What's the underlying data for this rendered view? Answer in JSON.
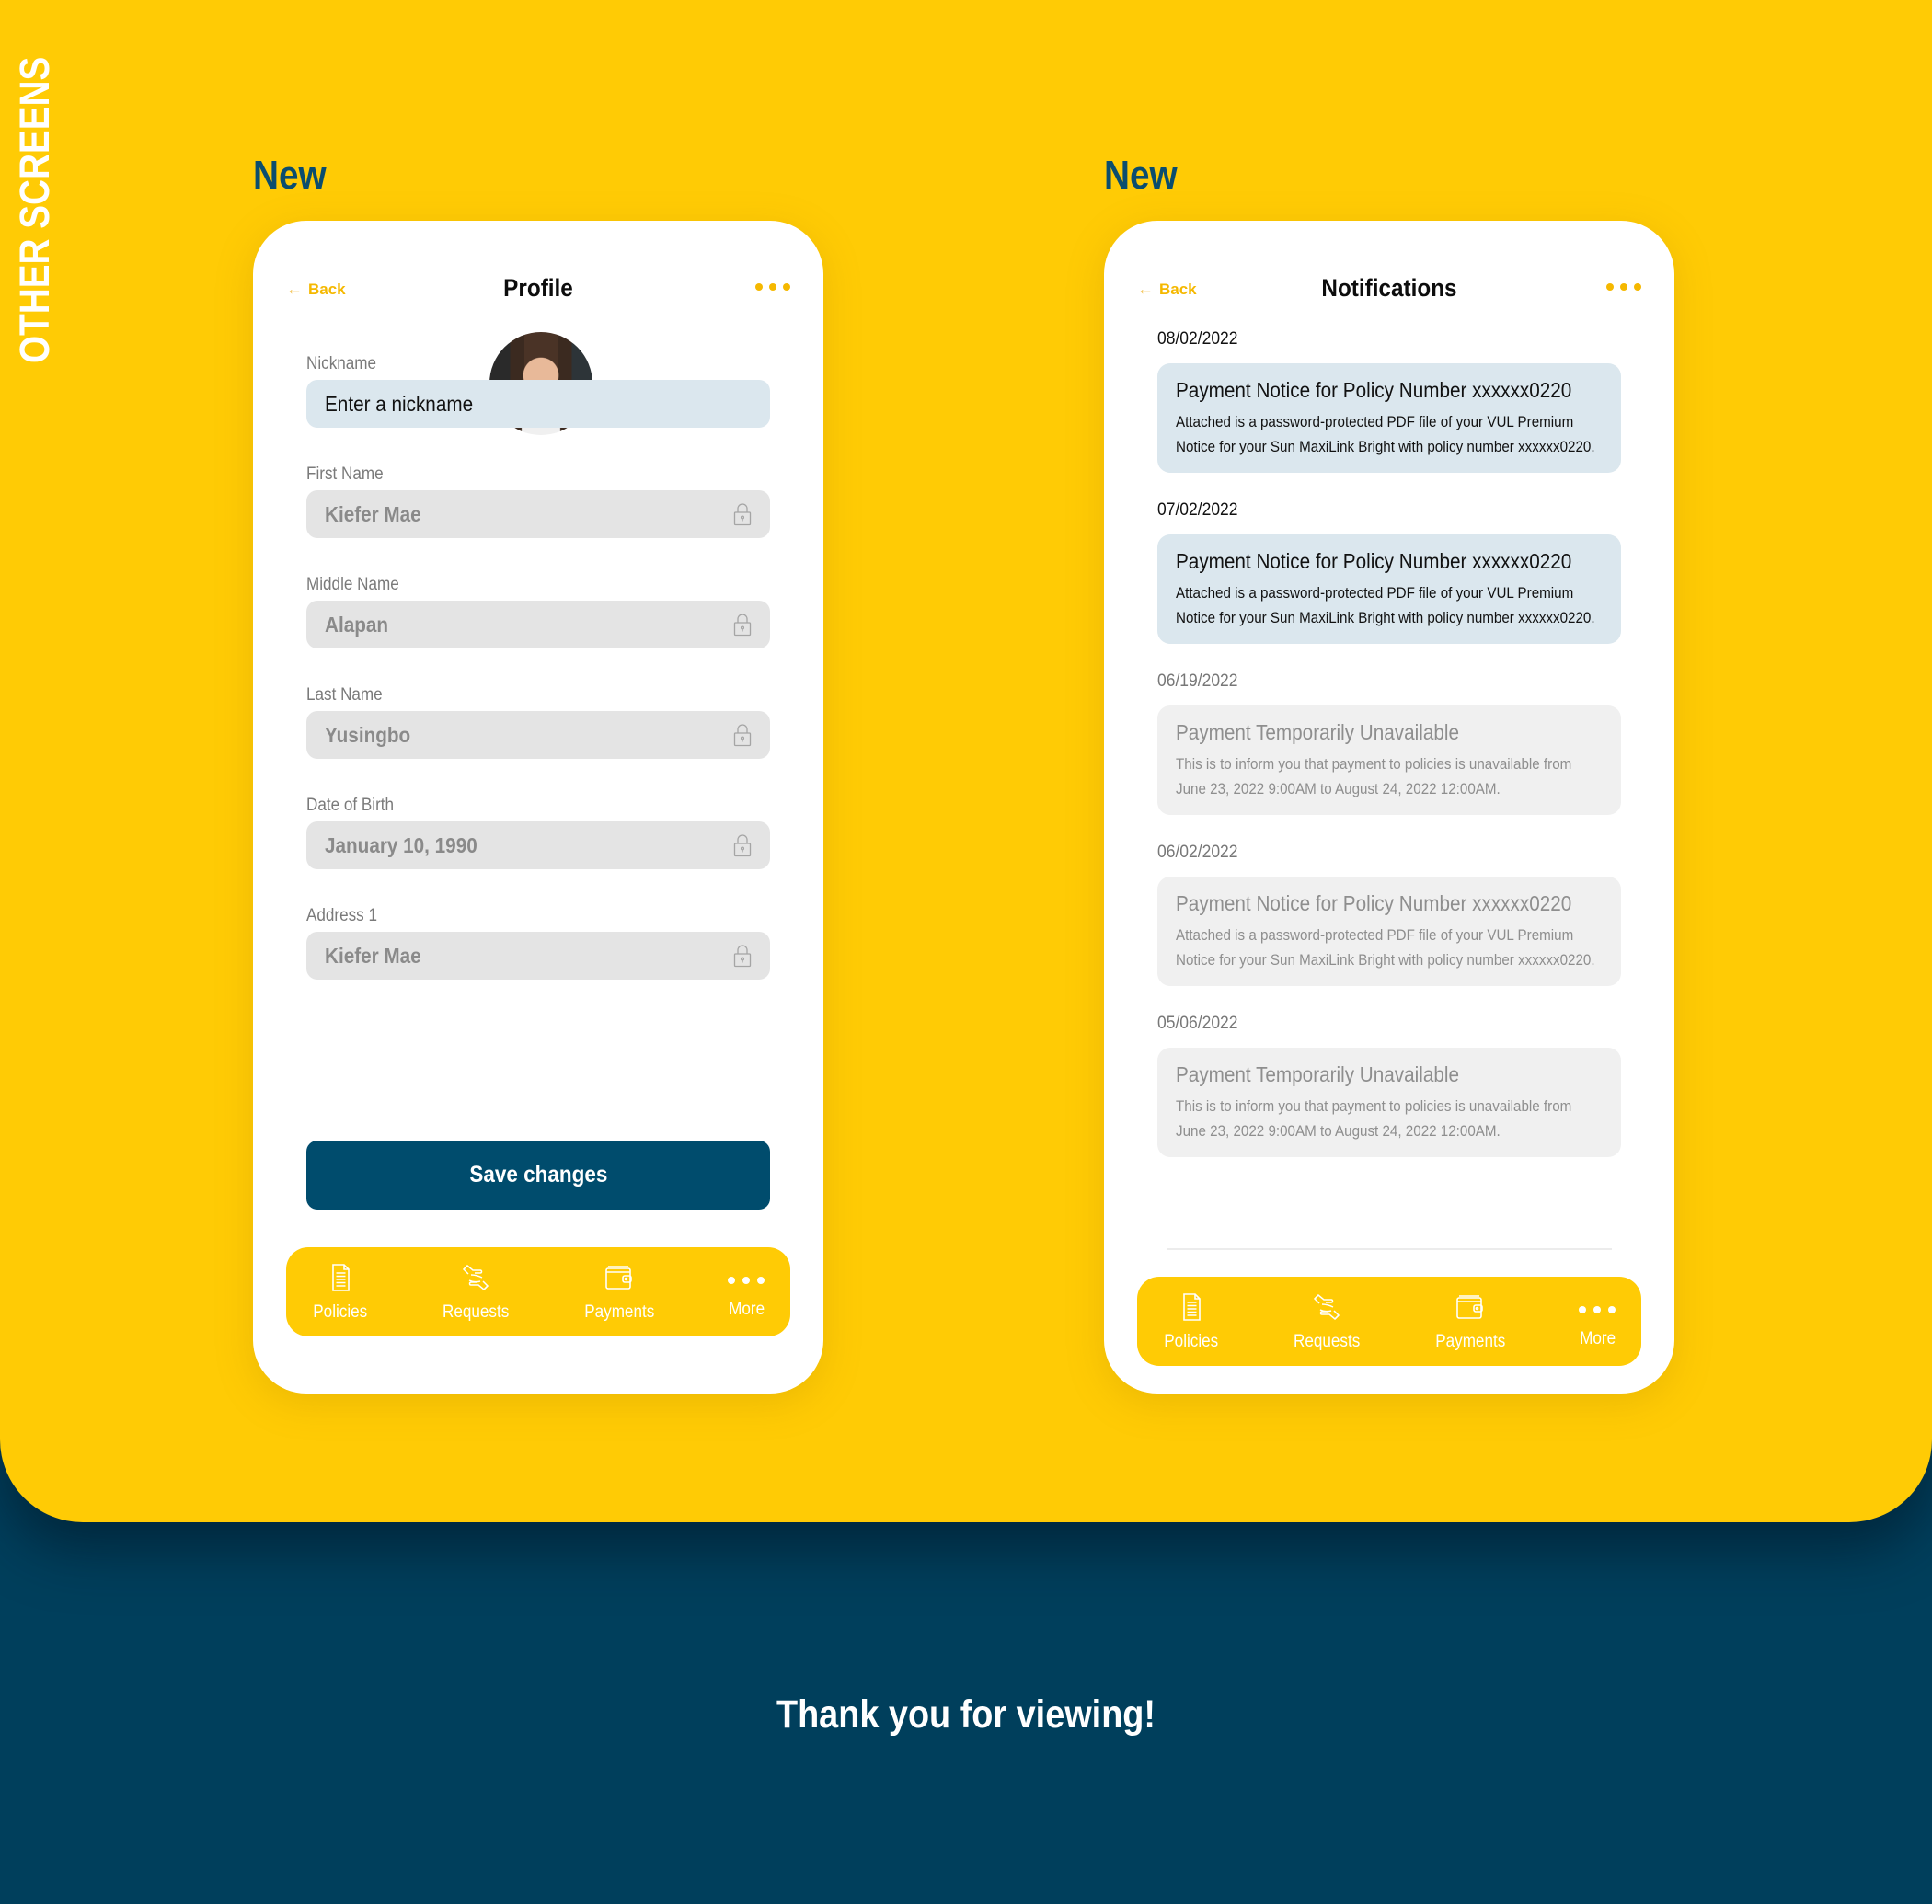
{
  "section_title": "OTHER SCREENS",
  "footer_text": "Thank you for viewing!",
  "colors": {
    "yellow": "#ffcb05",
    "navy": "#003f5c",
    "primary_button": "#004c6d",
    "label_blue": "#0b4d6e",
    "unread_card": "#dbe7ee",
    "read_card": "#f0f0f0",
    "locked_field": "#e4e4e4"
  },
  "profile_screen": {
    "version_label": "New",
    "header": {
      "back_label": "Back",
      "title": "Profile",
      "menu_icon": "more-horizontal-icon"
    },
    "avatar_icon": "profile-photo",
    "fields": [
      {
        "label": "Nickname",
        "value": "",
        "placeholder": "Enter a nickname",
        "locked": false
      },
      {
        "label": "First Name",
        "value": "Kiefer Mae",
        "locked": true
      },
      {
        "label": "Middle Name",
        "value": "Alapan",
        "locked": true
      },
      {
        "label": "Last Name",
        "value": "Yusingbo",
        "locked": true
      },
      {
        "label": "Date of Birth",
        "value": "January 10, 1990",
        "locked": true
      },
      {
        "label": "Address 1",
        "value": "Kiefer Mae",
        "locked": true
      }
    ],
    "save_label": "Save changes",
    "nav": [
      {
        "label": "Policies",
        "icon": "document-icon"
      },
      {
        "label": "Requests",
        "icon": "hands-exchange-icon"
      },
      {
        "label": "Payments",
        "icon": "wallet-icon"
      },
      {
        "label": "More",
        "icon": "more-horizontal-icon"
      }
    ]
  },
  "notifications_screen": {
    "version_label": "New",
    "header": {
      "back_label": "Back",
      "title": "Notifications",
      "menu_icon": "more-horizontal-icon"
    },
    "items": [
      {
        "date": "08/02/2022",
        "title": "Payment Notice for Policy Number xxxxxx0220",
        "body": "Attached is a password-protected PDF file of your VUL Premium Notice for your Sun MaxiLink Bright with policy number xxxxxx0220.",
        "read": false
      },
      {
        "date": "07/02/2022",
        "title": "Payment Notice for Policy Number xxxxxx0220",
        "body": "Attached is a password-protected PDF file of your VUL Premium Notice for your Sun MaxiLink Bright with policy number xxxxxx0220.",
        "read": false
      },
      {
        "date": "06/19/2022",
        "title": "Payment Temporarily Unavailable",
        "body": "This is to inform you that payment to policies is unavailable from June 23, 2022 9:00AM to August 24, 2022 12:00AM.",
        "read": true
      },
      {
        "date": "06/02/2022",
        "title": "Payment Notice for Policy Number xxxxxx0220",
        "body": "Attached is a password-protected PDF file of your VUL Premium Notice for your Sun MaxiLink Bright with policy number xxxxxx0220.",
        "read": true
      },
      {
        "date": "05/06/2022",
        "title": "Payment Temporarily Unavailable",
        "body": "This is to inform you that payment to policies is unavailable from June 23, 2022 9:00AM to August 24, 2022 12:00AM.",
        "read": true
      }
    ],
    "nav": [
      {
        "label": "Policies",
        "icon": "document-icon"
      },
      {
        "label": "Requests",
        "icon": "hands-exchange-icon"
      },
      {
        "label": "Payments",
        "icon": "wallet-icon"
      },
      {
        "label": "More",
        "icon": "more-horizontal-icon"
      }
    ]
  }
}
